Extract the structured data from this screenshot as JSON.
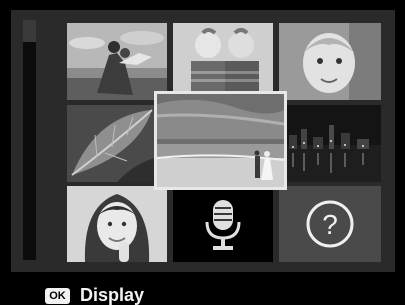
{
  "screen": {
    "bottom_bar": {
      "ok_button_label": "OK",
      "action_label": "Display"
    }
  },
  "thumbnails": [
    {
      "name": "thumbnail-couple-field",
      "content": "photo"
    },
    {
      "name": "thumbnail-two-boys",
      "content": "photo"
    },
    {
      "name": "thumbnail-baby-girl",
      "content": "photo"
    },
    {
      "name": "thumbnail-leaf-closeup",
      "content": "photo"
    },
    {
      "name": "thumbnail-beach-couple",
      "content": "photo",
      "selected": true
    },
    {
      "name": "thumbnail-city-night",
      "content": "photo"
    },
    {
      "name": "thumbnail-smiling-woman",
      "content": "photo"
    },
    {
      "name": "thumbnail-voice-memo",
      "content": "microphone-icon"
    },
    {
      "name": "thumbnail-unknown-file",
      "content": "question-mark-icon"
    }
  ],
  "colors": {
    "background": "#000000",
    "panel": "#2a2a2a",
    "selection_border": "#e8e8e8",
    "text": "#f2f2f2"
  }
}
